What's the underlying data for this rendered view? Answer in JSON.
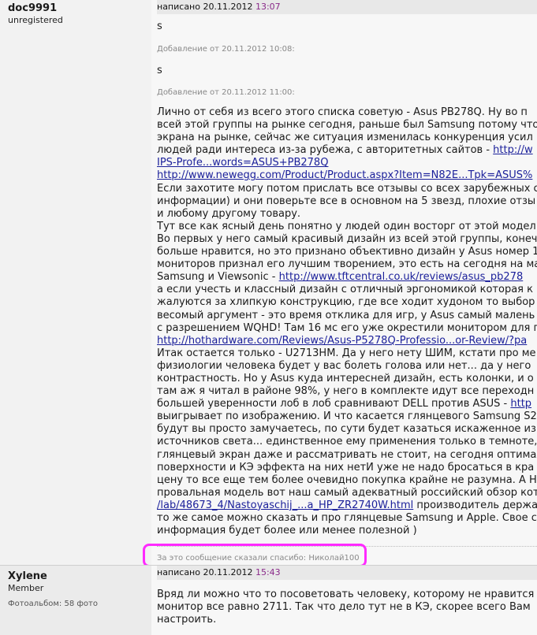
{
  "post1": {
    "author": {
      "name": "doc9991",
      "role": "unregistered"
    },
    "date_prefix": "написано 20.11.2012 ",
    "date_time": "13:07",
    "line1": "s",
    "addition1": "Добавление от 20.11.2012 10:08:",
    "line2": "s",
    "addition2": "Добавление от 20.11.2012 11:00:",
    "body_lines": [
      [
        {
          "t": "Лично от себя из всего этого списка советую - Asus PB278Q. Ну во п"
        }
      ],
      [
        {
          "t": "всей этой группы на рынке сегодня, раньше был Samsung потому что "
        }
      ],
      [
        {
          "t": "экрана на рынке, сейчас же ситуация изменилась конкуренция усил"
        }
      ],
      [
        {
          "t": "людей ради интереса из-за рубежа, с авторитетных сайтов - "
        },
        {
          "t": "http://w",
          "link": true
        }
      ],
      [
        {
          "t": "IPS-Profe...words=ASUS+PB278Q",
          "link": true
        }
      ],
      [
        {
          "t": "http://www.newegg.com/Product/Product.aspx?Item=N82E...Tpk=ASUS%",
          "link": true
        }
      ],
      [
        {
          "t": "Если захотите могу потом прислать все отзывы со всех зарубежных с"
        }
      ],
      [
        {
          "t": "информации) и они поверьте все в основном на 5 звезд, плохие отзы"
        }
      ],
      [
        {
          "t": "и любому другому товару."
        }
      ],
      [
        {
          "t": "Тут все как ясный день понятно у людей один восторг от этой модел"
        }
      ],
      [
        {
          "t": "Во первых у него самый красивый дизайн из всей этой группы, конеч"
        }
      ],
      [
        {
          "t": "больше нравится, но это признано объективно дизайн у Asus номер 1"
        }
      ],
      [
        {
          "t": "мониторов признал его лучшим творением, это есть на сегодня на ма"
        }
      ],
      [
        {
          "t": "Samsung и Viewsonic - "
        },
        {
          "t": "http://www.tftcentral.co.uk/reviews/asus_pb278",
          "link": true
        }
      ],
      [
        {
          "t": "а если учесть и классный дизайн с отличный эргономикой которая к"
        }
      ],
      [
        {
          "t": "жалуются за хлипкую конструкцию, где все ходит худоном то выбор"
        }
      ],
      [
        {
          "t": "весомый аргумент - это время отклика для игр, у Asus самый малень"
        }
      ],
      [
        {
          "t": "с разрешением WQHD! Там 16 мс его уже окрестили монитором для г"
        }
      ],
      [
        {
          "t": "http://hothardware.com/Reviews/Asus-P5278Q-Professio...or-Review/?pa",
          "link": true
        }
      ],
      [
        {
          "t": "Итак остается только - U2713HM. Да у него нету ШИМ, кстати про ме"
        }
      ],
      [
        {
          "t": "физиологии человека будет у вас болеть голова или нет... да у него"
        }
      ],
      [
        {
          "t": "контрастность. Но у Asus куда интересней дизайн, есть колонки, и о"
        }
      ],
      [
        {
          "t": "там аж я читал в районе 98%, у него в комплекте идут все переходн"
        }
      ],
      [
        {
          "t": "большей уверенности лоб в лоб сравнивают DELL против ASUS - "
        },
        {
          "t": "http",
          "link": true
        }
      ],
      [
        {
          "t": "выигрывает по изображению. И что касается глянцевого Samsung S2"
        }
      ],
      [
        {
          "t": "будут вы просто замучаетесь, по сути будет казаться искаженное из"
        }
      ],
      [
        {
          "t": "источников света... единственное ему применения только в темноте,"
        }
      ],
      [
        {
          "t": "глянцевый экран даже и рассматривать не стоит, на сегодня оптимал"
        }
      ],
      [
        {
          "t": "поверхности и КЭ эффекта на них нетИ уже не надо бросаться в кра"
        }
      ],
      [
        {
          "t": "цену то все еще тем более очевидно покупка крайне не разумна. А Н"
        }
      ],
      [
        {
          "t": "провальная модель вот наш самый адекватный российский обзор кот"
        }
      ],
      [
        {
          "t": "/lab/48673_4/Nastoyaschij_...a_HP_ZR2740W.html",
          "link": true
        },
        {
          "t": " производитель держа"
        }
      ],
      [
        {
          "t": "то же самое можно сказать и про глянцевые Samsung и Apple. Свое с"
        }
      ],
      [
        {
          "t": "информация будет более или менее полезной )"
        }
      ]
    ],
    "thanks": "За это сообщение сказали спасибо: Николай100"
  },
  "post2": {
    "author": {
      "name": "Xylene",
      "role": "Member",
      "album": "Фотоальбом: 58 фото"
    },
    "date_prefix": "написано 20.11.2012 ",
    "date_time": "15:43",
    "body_lines": [
      [
        {
          "t": "Вряд ли можно что то посоветовать человеку, которому не нравится"
        }
      ],
      [
        {
          "t": "монитор все равно 2711. Так что дело тут не в КЭ, скорее всего Вам"
        }
      ],
      [
        {
          "t": "настроить."
        }
      ]
    ]
  },
  "colors": {
    "time": "#8a2a8a",
    "link": "#1a1f9a",
    "highlight": "#ff2aff"
  }
}
